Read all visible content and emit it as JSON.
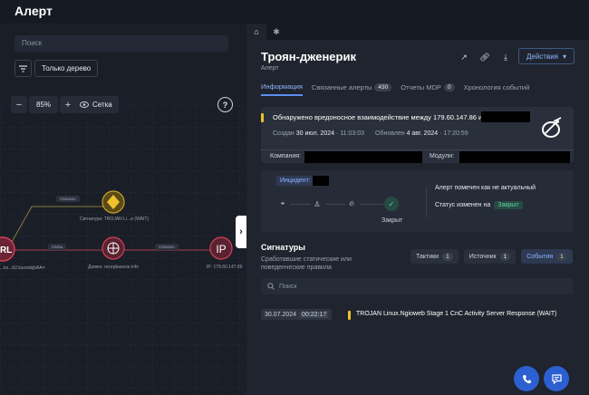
{
  "app": {
    "title": "Алерт"
  },
  "left": {
    "search_placeholder": "Поиск",
    "tree_only_label": "Только дерево",
    "zoom_value": "85%",
    "zoom_minus": "−",
    "zoom_plus": "+",
    "grid_label": "Сетка",
    "help_label": "?",
    "graph": {
      "nodes": [
        {
          "label": "URL",
          "caption": "...ks...b2.liuoedsjbAA="
        },
        {
          "label": "",
          "caption": "Сигнатура: TROJAN Li...e (WAIT)"
        },
        {
          "label": "",
          "caption": "Домен: recepbasoxe.info"
        },
        {
          "label": "IP",
          "caption": "IP: 179.60.147.86"
        }
      ],
      "edges": [
        "Связано",
        "Связь",
        "Связано"
      ]
    }
  },
  "right": {
    "title": "Троян-дженерик",
    "subtitle": "Алерт",
    "actions_label": "Действия",
    "tabs": [
      {
        "label": "Информация",
        "count": ""
      },
      {
        "label": "Связанные алерты",
        "count": "430"
      },
      {
        "label": "Отчеты MDP",
        "count": "0"
      },
      {
        "label": "Хронология событий",
        "count": ""
      }
    ],
    "alert_card": {
      "title": "Обнаружено вредоносное взаимодействие между 179.60.147.86 и",
      "created_label": "Создан",
      "created_date": "30 июл. 2024",
      "created_time": "· 11:03:03",
      "updated_label": "Обновлен",
      "updated_date": "4 авг. 2024",
      "updated_time": "· 17:20:59",
      "company_label": "Компания:",
      "modules_label": "Модули:"
    },
    "incident": {
      "label": "Инцидент:",
      "closed_label": "Закрыт",
      "status_text_1": "Алерт помечен как не актуальный",
      "status_text_2": "Статус изменен на",
      "status_value": "Закрыт"
    },
    "signatures": {
      "title": "Сигнатуры",
      "subtitle": "Сработавшие статические или поведенческие правила",
      "tabs": [
        {
          "label": "Тактики",
          "count": "1"
        },
        {
          "label": "Источник",
          "count": "1"
        },
        {
          "label": "События",
          "count": "1"
        }
      ],
      "search_placeholder": "Поиск",
      "rows": [
        {
          "date": "30.07.2024",
          "time": "00:22:17",
          "text": "TROJAN Linux.Ngioweb Stage 1 CnC Activity Server Response (WAIT)"
        }
      ]
    }
  },
  "colors": {
    "accent": "#5c8ef0",
    "warning": "#f0c22e",
    "success": "#5fd1a7",
    "danger": "#d6405a"
  },
  "icons": [
    "home-icon",
    "asterisk-icon",
    "external-link-icon",
    "link-icon",
    "download-icon",
    "chevron-down-icon",
    "filter-icon",
    "eye-icon",
    "help-icon",
    "collapse-chevron-icon",
    "crosshair-icon",
    "user-icon",
    "fire-icon",
    "check-icon",
    "search-icon",
    "phone-icon",
    "chat-icon",
    "satellite-icon"
  ]
}
